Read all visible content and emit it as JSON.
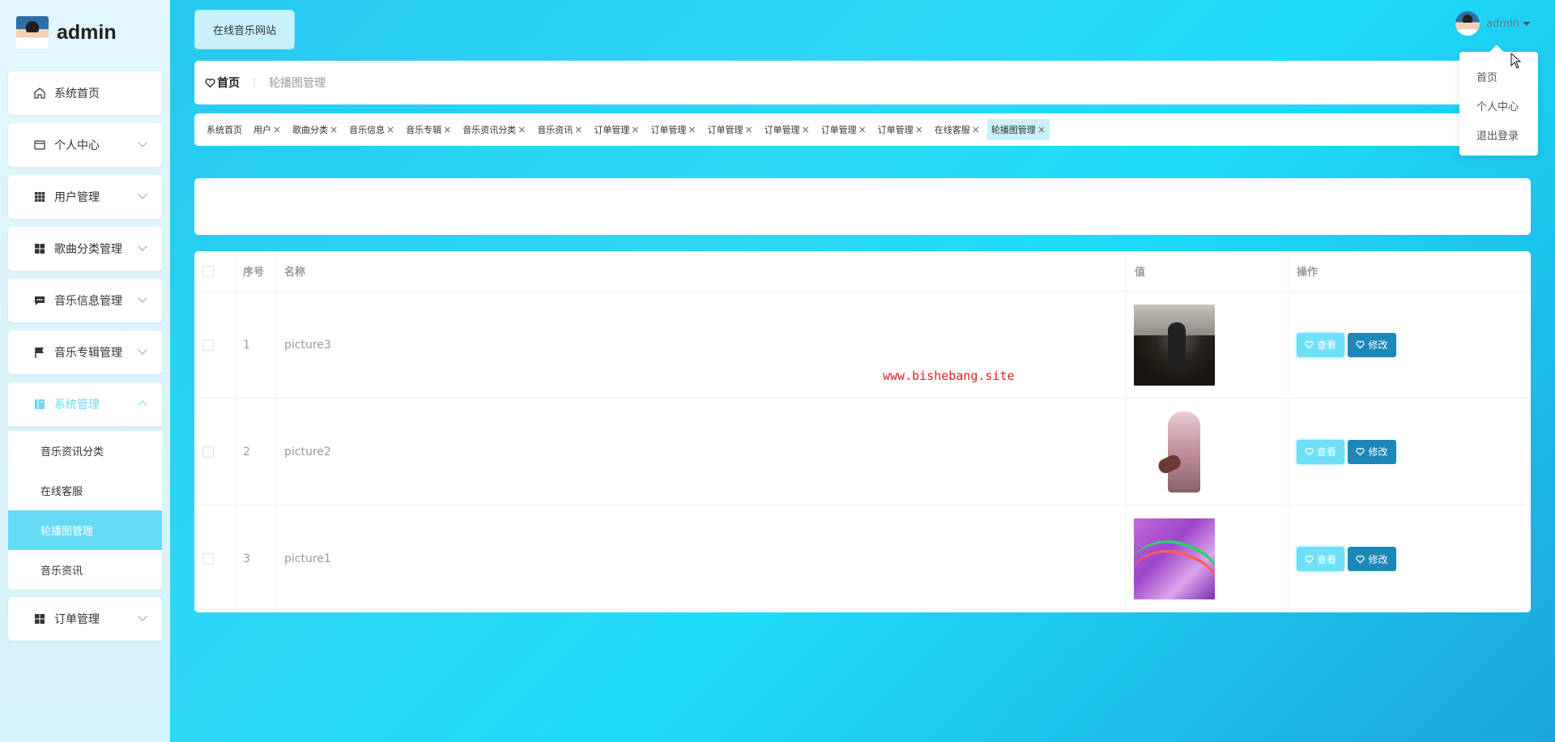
{
  "sidebar": {
    "user_name": "admin",
    "items": [
      {
        "label": "系统首页",
        "icon": "home-icon"
      },
      {
        "label": "个人中心",
        "icon": "card-icon"
      },
      {
        "label": "用户管理",
        "icon": "grid-icon"
      },
      {
        "label": "歌曲分类管理",
        "icon": "apps-icon"
      },
      {
        "label": "音乐信息管理",
        "icon": "message-icon"
      },
      {
        "label": "音乐专辑管理",
        "icon": "flag-icon"
      },
      {
        "label": "系统管理",
        "icon": "book-icon"
      },
      {
        "label": "订单管理",
        "icon": "apps-icon"
      }
    ],
    "sub_items": [
      {
        "label": "音乐资讯分类"
      },
      {
        "label": "在线客服"
      },
      {
        "label": "轮播图管理"
      },
      {
        "label": "音乐资讯"
      }
    ]
  },
  "header": {
    "site_button": "在线音乐网站",
    "breadcrumb_home": "首页",
    "breadcrumb_current": "轮播图管理",
    "user_name": "admin"
  },
  "tabs": [
    {
      "label": "系统首页"
    },
    {
      "label": "用户"
    },
    {
      "label": "歌曲分类"
    },
    {
      "label": "音乐信息"
    },
    {
      "label": "音乐专辑"
    },
    {
      "label": "音乐资讯分类"
    },
    {
      "label": "音乐资讯"
    },
    {
      "label": "订单管理"
    },
    {
      "label": "订单管理"
    },
    {
      "label": "订单管理"
    },
    {
      "label": "订单管理"
    },
    {
      "label": "订单管理"
    },
    {
      "label": "订单管理"
    },
    {
      "label": "在线客服"
    },
    {
      "label": "轮播图管理"
    }
  ],
  "table": {
    "columns": {
      "index": "序号",
      "name": "名称",
      "value": "值",
      "actions": "操作"
    },
    "rows": [
      {
        "index": "1",
        "name": "picture3"
      },
      {
        "index": "2",
        "name": "picture2"
      },
      {
        "index": "3",
        "name": "picture1"
      }
    ],
    "view_label": "查看",
    "edit_label": "修改"
  },
  "watermark": "www.bishebang.site",
  "dropdown": [
    "首页",
    "个人中心",
    "退出登录"
  ],
  "colors": {
    "accent": "#67dbf5",
    "edit_button": "#1d87b8",
    "watermark": "#e02020"
  }
}
